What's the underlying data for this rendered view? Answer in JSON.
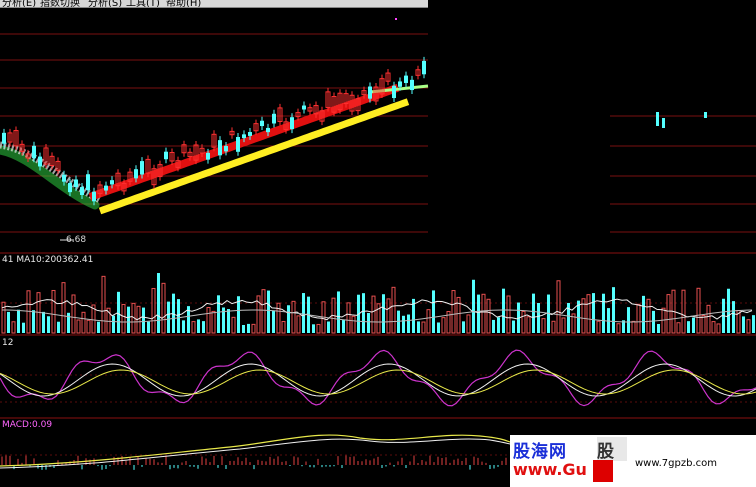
{
  "menu": {
    "items": [
      "分析(E)",
      "指数切换",
      "分析(S)",
      "工具(T)",
      "帮助(H)"
    ]
  },
  "price_chart": {
    "low_label": "6.68",
    "colors": {
      "up": "#ff3030",
      "down": "#54ffff",
      "ma_red": "#e01010",
      "ma_yellow": "#ffee22",
      "ma_white": "#e8e8e8",
      "ma_green": "#2ecc40"
    }
  },
  "volume_panel": {
    "label": "41 MA10:200362.41"
  },
  "kdj_panel": {
    "label": "12"
  },
  "macd_panel": {
    "label": "MACD:0.09"
  },
  "watermark": {
    "logo_line1": "股海网",
    "logo_line2": "www.Gu",
    "right_char": "股",
    "url": "www.7gpzb.com"
  }
}
